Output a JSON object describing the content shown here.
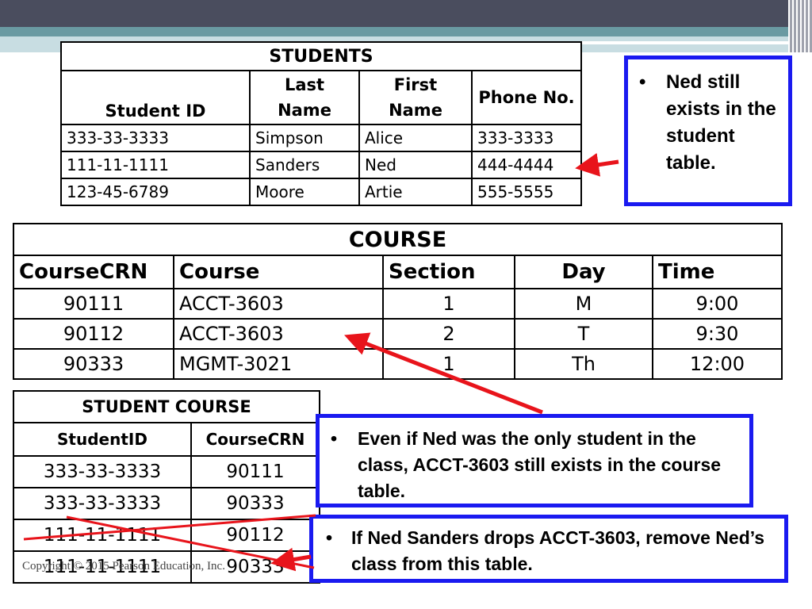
{
  "students": {
    "title": "STUDENTS",
    "headers": [
      "Student ID",
      "Last Name",
      "First Name",
      "Phone No."
    ],
    "rows": [
      [
        "333-33-3333",
        "Simpson",
        "Alice",
        "333-3333"
      ],
      [
        "111-11-1111",
        "Sanders",
        "Ned",
        "444-4444"
      ],
      [
        "123-45-6789",
        "Moore",
        "Artie",
        "555-5555"
      ]
    ]
  },
  "course": {
    "title": "COURSE",
    "headers": [
      "CourseCRN",
      "Course",
      "Section",
      "Day",
      "Time"
    ],
    "rows": [
      [
        "90111",
        "ACCT-3603",
        "1",
        "M",
        "9:00"
      ],
      [
        "90112",
        "ACCT-3603",
        "2",
        "T",
        "9:30"
      ],
      [
        "90333",
        "MGMT-3021",
        "1",
        "Th",
        "12:00"
      ]
    ]
  },
  "student_course": {
    "title": "STUDENT COURSE",
    "headers": [
      "StudentID",
      "CourseCRN"
    ],
    "rows": [
      [
        "333-33-3333",
        "90111"
      ],
      [
        "333-33-3333",
        "90333"
      ],
      [
        "111-11-1111",
        "90112"
      ],
      [
        "111-11-1111",
        "90333"
      ]
    ]
  },
  "callouts": {
    "ned_exists": "Ned still exists in the student table.",
    "course_exists": "Even if Ned was the only student in the class, ACCT-3603 still exists in the course table.",
    "drop": "If Ned Sanders drops ACCT-3603, remove Ned’s class from this table."
  },
  "bullet": "•",
  "copyright": "Copyright © 2015 Pearson Education, Inc.",
  "colors": {
    "callout_border": "#1a1af0",
    "arrow": "#e8141b",
    "header_bar": "#4a4d5e",
    "teal_bar": "#6a9aa2"
  }
}
